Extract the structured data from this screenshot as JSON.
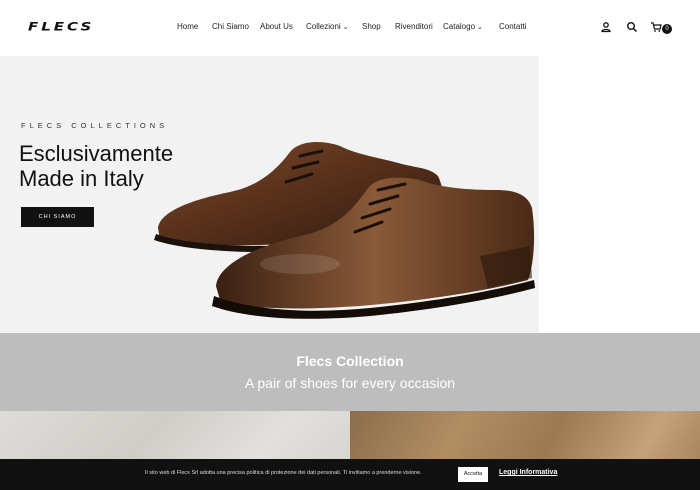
{
  "header": {
    "logo": "FLECS",
    "nav": [
      "Home",
      "Chi Siamo",
      "About Us",
      "Collezioni",
      "Shop",
      "Rivenditori",
      "Catalogo",
      "Contatti"
    ],
    "cart_count": "0"
  },
  "hero": {
    "kicker": "FLECS COLLECTIONS",
    "title_line1": "Esclusivamente",
    "title_line2": "Made in Italy",
    "button": "CHI SIAMO"
  },
  "band": {
    "title": "Flecs Collection",
    "subtitle": "A pair of shoes for every occasion"
  },
  "cookie": {
    "text": "Il sito web di Flecs Srl adotta una precisa politica di protezione dei dati personali. Ti invitiamo a prenderne visione.",
    "accept": "Accetta",
    "more": "Leggi Informativa"
  },
  "colors": {
    "accent": "#111111",
    "band": "#bdbdbd",
    "hero_bg": "#f2f2f2"
  }
}
